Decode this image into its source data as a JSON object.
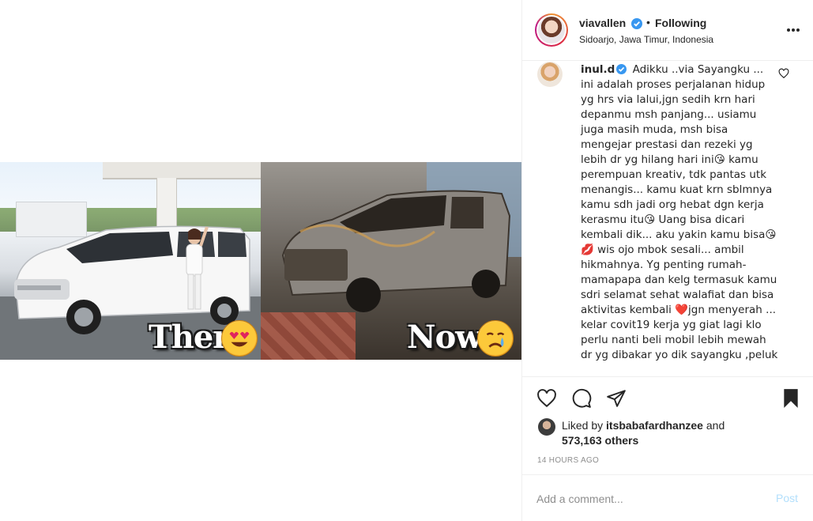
{
  "post": {
    "image": {
      "caption_left": "Then",
      "caption_right": "Now",
      "emoji_left": "heart-eyes-emoji",
      "emoji_right": "crying-emoji"
    }
  },
  "header": {
    "username": "viavallen",
    "separator": "•",
    "follow_status": "Following",
    "location": "Sidoarjo, Jawa Timur, Indonesia",
    "verified_color": "#3897f0"
  },
  "comment": {
    "username": "inul.d",
    "text": "Adikku ..via Sayangku ... ini adalah proses perjalanan hidup yg hrs via lalui,jgn sedih krn hari depanmu msh panjang... usiamu juga masih muda, msh bisa mengejar prestasi dan rezeki yg lebih dr yg hilang hari ini😘 kamu perempuan kreativ, tdk pantas utk menangis... kamu kuat krn sblmnya kamu sdh jadi org hebat dgn kerja kerasmu itu😘 Uang bisa dicari kembali dik... aku yakin kamu bisa😘💋 wis ojo mbok sesali... ambil hikmahnya. Yg penting rumah-mamapapa dan kelg termasuk kamu sdri selamat sehat walafiat dan bisa aktivitas kembali ❤️jgn menyerah ... kelar covit19 kerja yg giat lagi klo perlu nanti beli mobil lebih mewah dr yg dibakar yo dik sayangku ,peluk"
  },
  "likes": {
    "prefix": "Liked by",
    "user": "itsbabafardhanzee",
    "connector": "and",
    "count": "573,163 others"
  },
  "timestamp": "14 HOURS AGO",
  "add_comment": {
    "placeholder": "Add a comment...",
    "post_label": "Post"
  },
  "colors": {
    "text": "#262626",
    "muted": "#8e8e8e",
    "border": "#efefef",
    "post_button_disabled": "#b2dffc"
  }
}
